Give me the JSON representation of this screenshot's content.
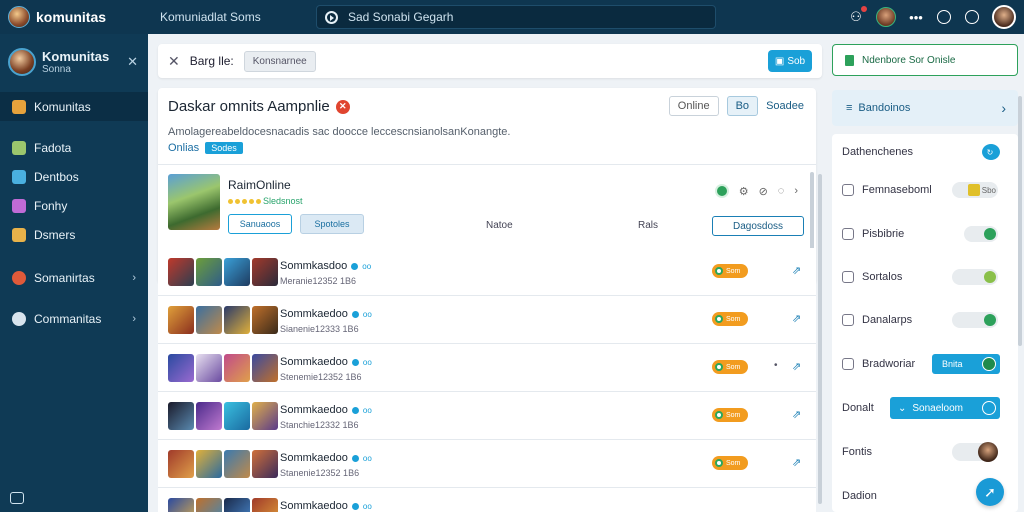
{
  "topbar": {
    "brand": "komunitas",
    "title": "Komuniadlat Soms",
    "search_text": "Sad Sonabi Gegarh"
  },
  "sidebar": {
    "name": "Komunitas",
    "sub": "Sonna",
    "items": [
      {
        "label": "Komunitas",
        "active": true,
        "color": "#e6a23c"
      },
      {
        "label": "Fadota",
        "color": "#9bc66d"
      },
      {
        "label": "Dentbos",
        "color": "#4ab0e0"
      },
      {
        "label": "Fonhy",
        "color": "#c06bd6"
      },
      {
        "label": "Dsmers",
        "color": "#e8b24a"
      },
      {
        "label": "Somanirtas",
        "color": "#e05a3a"
      },
      {
        "label": "Commanitas",
        "color": "#d8e4ee"
      }
    ]
  },
  "crumb": {
    "label": "Barg lle:",
    "chip": "Konsnarnee",
    "btn": "Sob"
  },
  "card": {
    "title": "Daskar omnits Aampnlie",
    "tab1": "Online",
    "tab2": "Bo",
    "tab_link": "Soadee",
    "desc": "Amolagereabeldocesnacadis sac doocce leccescnsianolsanKonangte.",
    "meta": "Onlias",
    "meta_chip": "Sodes",
    "game_name": "RaimOnline",
    "game_stars_text": "Sledsnost",
    "btn1": "Sanuaoos",
    "btn2": "Spotoles",
    "col_a": "Natoe",
    "col_b": "Rals",
    "btn3": "Dagosdoss"
  },
  "rows": [
    {
      "name": "Sommkasdoo",
      "tag": "oo",
      "sub": "Meranie12352 1B6",
      "pill": "Som"
    },
    {
      "name": "Sommkaedoo",
      "tag": "oo",
      "sub": "Sianenie12333 1B6",
      "pill": "Som"
    },
    {
      "name": "Sommkaedoo",
      "tag": "oo",
      "sub": "Stenemie12352 1B6",
      "pill": "Som"
    },
    {
      "name": "Sommkaedoo",
      "tag": "oo",
      "sub": "Stanchie12332 1B6",
      "pill": "Som"
    },
    {
      "name": "Sommkaedoo",
      "tag": "oo",
      "sub": "Stanenie12352 1B6",
      "pill": "Som"
    },
    {
      "name": "Sommkaedoo",
      "tag": "oo",
      "sub": "",
      "pill": ""
    }
  ],
  "rpanel": {
    "top": "Ndenbore Sor Onisle",
    "block": "Bandoinos",
    "rows": [
      {
        "label": "Dathenchenes"
      },
      {
        "label": "Femnaseboml",
        "tog": "Sbo"
      },
      {
        "label": "Pisbibrie"
      },
      {
        "label": "Sortalos"
      },
      {
        "label": "Danalarps"
      },
      {
        "label": "Bradworiar",
        "sel": "Bnita"
      },
      {
        "label": "Donalt",
        "select": "Sonaeloom"
      },
      {
        "label": "Fontis"
      },
      {
        "label": "Dadion"
      }
    ]
  }
}
